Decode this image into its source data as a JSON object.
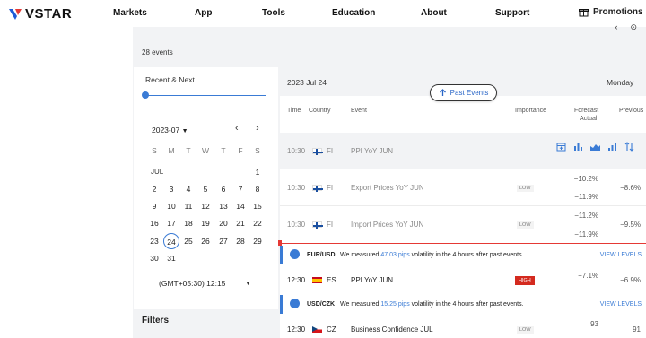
{
  "nav": {
    "brand": "VSTAR",
    "items": [
      "Markets",
      "App",
      "Tools",
      "Education",
      "About",
      "Support"
    ],
    "promotions": "Promotions"
  },
  "events_count": "28 events",
  "sidebar": {
    "range_label": "Recent & Next",
    "month": "2023-07",
    "weekdays": [
      "S",
      "M",
      "T",
      "W",
      "T",
      "F",
      "S"
    ],
    "month_label": "JUL",
    "weeks": [
      [
        "",
        "",
        "",
        "",
        "",
        "",
        "1"
      ],
      [
        "2",
        "3",
        "4",
        "5",
        "6",
        "7",
        "8"
      ],
      [
        "9",
        "10",
        "11",
        "12",
        "13",
        "14",
        "15"
      ],
      [
        "16",
        "17",
        "18",
        "19",
        "20",
        "21",
        "22"
      ],
      [
        "23",
        "24",
        "25",
        "26",
        "27",
        "28",
        "29"
      ],
      [
        "30",
        "31",
        "",
        "",
        "",
        "",
        ""
      ]
    ],
    "selected_day": "24",
    "timezone": "(GMT+05:30) 12:15",
    "filters": "Filters"
  },
  "main": {
    "date": "2023 Jul 24",
    "weekday": "Monday",
    "past_events": "Past Events",
    "columns": {
      "time": "Time",
      "country": "Country",
      "event": "Event",
      "importance": "Importance",
      "forecast": "Forecast",
      "actual": "Actual",
      "previous": "Previous"
    },
    "rows": [
      {
        "time": "10:30",
        "country": "FI",
        "event": "PPI YoY JUN",
        "importance": "",
        "forecast": "",
        "actual": "",
        "previous": ""
      },
      {
        "time": "10:30",
        "country": "FI",
        "event": "Export Prices YoY JUN",
        "importance": "LOW",
        "forecast": "−10.2%",
        "actual": "−11.9%",
        "previous": "−8.6%"
      },
      {
        "time": "10:30",
        "country": "FI",
        "event": "Import Prices YoY JUN",
        "importance": "LOW",
        "forecast": "−11.2%",
        "actual": "−11.9%",
        "previous": "−9.5%"
      },
      {
        "time": "12:30",
        "country": "ES",
        "event": "PPI YoY JUN",
        "importance": "HIGH",
        "forecast": "−7.1%",
        "actual": "",
        "previous": "−6.9%"
      },
      {
        "time": "12:30",
        "country": "CZ",
        "event": "Business Confidence JUL",
        "importance": "LOW",
        "forecast": "93",
        "actual": "",
        "previous": "91"
      }
    ],
    "banners": [
      {
        "pair": "EUR/USD",
        "msg_pre": "We measured ",
        "pips": "47.03 pips",
        "msg_post": " volatility in the 4 hours after past events.",
        "link": "VIEW LEVELS"
      },
      {
        "pair": "USD/CZK",
        "msg_pre": "We measured ",
        "pips": "15.25 pips",
        "msg_post": " volatility in the 4 hours after past events.",
        "link": "VIEW LEVELS"
      }
    ]
  },
  "colors": {
    "accent": "#3a7bd5",
    "high": "#d42a1f",
    "now_line": "#e53935"
  }
}
